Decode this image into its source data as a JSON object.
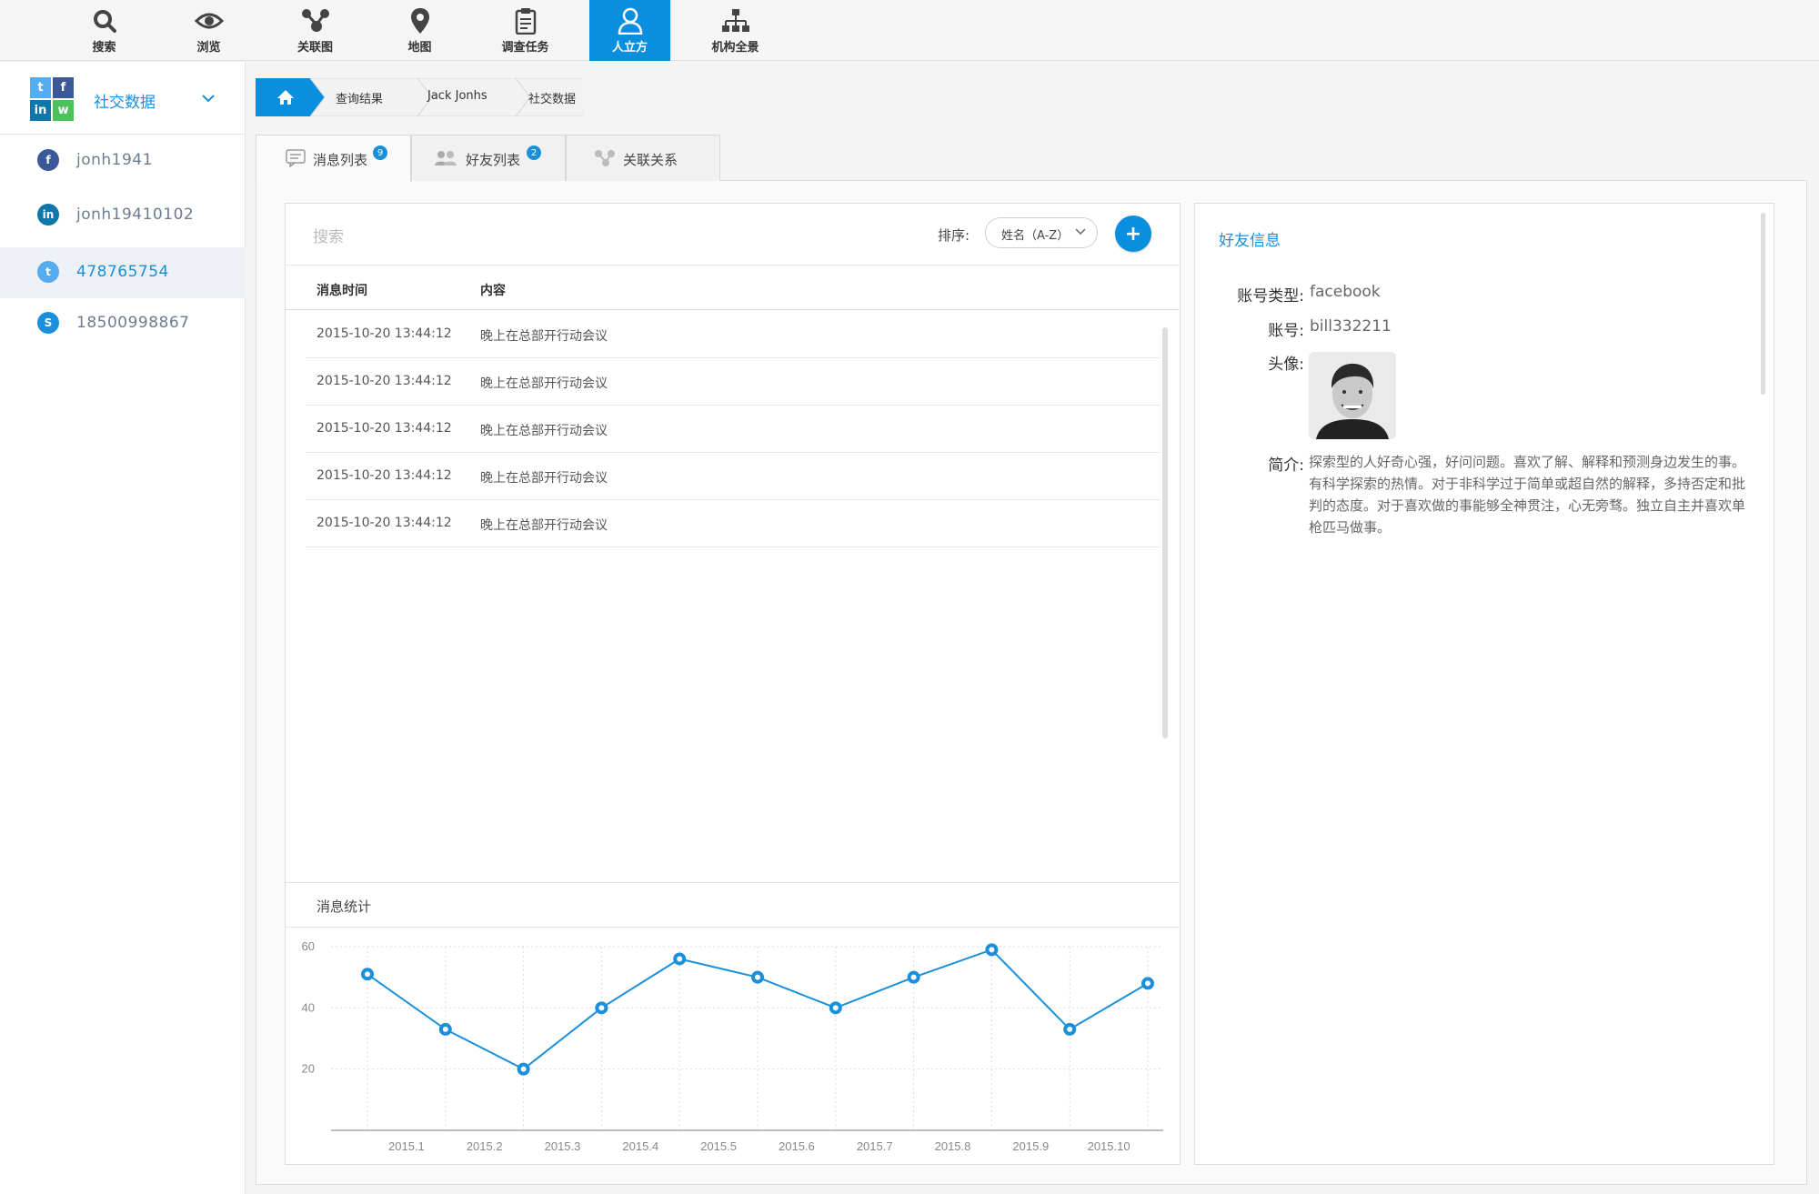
{
  "nav": {
    "items": [
      {
        "label": "搜索",
        "icon": "search-icon"
      },
      {
        "label": "浏览",
        "icon": "eye-icon"
      },
      {
        "label": "关联图",
        "icon": "graph-icon"
      },
      {
        "label": "地图",
        "icon": "map-pin-icon"
      },
      {
        "label": "调查任务",
        "icon": "clipboard-icon"
      },
      {
        "label": "人立方",
        "icon": "person-icon"
      },
      {
        "label": "机构全景",
        "icon": "org-chart-icon"
      }
    ],
    "active_index": 5,
    "accent_color": "#0a8fde"
  },
  "sidebar": {
    "title": "社交数据",
    "accounts": [
      {
        "label": "jonh1941",
        "icon": "facebook-icon",
        "color": "#3b5998"
      },
      {
        "label": "jonh19410102",
        "icon": "linkedin-icon",
        "color": "#0e76a8"
      },
      {
        "label": "478765754",
        "icon": "twitter-icon",
        "color": "#55acee"
      },
      {
        "label": "18500998867",
        "icon": "skype-icon",
        "color": "#1a8fdc"
      }
    ],
    "active_index": 2
  },
  "breadcrumb": {
    "items": [
      "查询结果",
      "Jack Jonhs",
      "社交数据"
    ]
  },
  "tabs": [
    {
      "label": "消息列表",
      "badge": "9",
      "icon": "message-icon"
    },
    {
      "label": "好友列表",
      "badge": "2",
      "icon": "friends-icon"
    },
    {
      "label": "关联关系",
      "badge": "",
      "icon": "relation-icon"
    }
  ],
  "messages": {
    "search_placeholder": "搜索",
    "sort_label": "排序:",
    "sort_value": "姓名（A-Z）",
    "add_label": "+",
    "columns": [
      "消息时间",
      "内容"
    ],
    "rows": [
      {
        "time": "2015-10-20 13:44:12",
        "content": "晚上在总部开行动会议"
      },
      {
        "time": "2015-10-20 13:44:12",
        "content": "晚上在总部开行动会议"
      },
      {
        "time": "2015-10-20 13:44:12",
        "content": "晚上在总部开行动会议"
      },
      {
        "time": "2015-10-20 13:44:12",
        "content": "晚上在总部开行动会议"
      },
      {
        "time": "2015-10-20 13:44:12",
        "content": "晚上在总部开行动会议"
      }
    ]
  },
  "stats": {
    "title": "消息统计"
  },
  "chart_data": {
    "type": "line",
    "x": [
      "2015.1",
      "2015.2",
      "2015.3",
      "2015.4",
      "2015.5",
      "2015.6",
      "2015.7",
      "2015.8",
      "2015.9",
      "2015.10"
    ],
    "series": [
      {
        "values": [
          51,
          33,
          20,
          40,
          56,
          50,
          40,
          50,
          59,
          33,
          48
        ]
      }
    ],
    "yticks": [
      20,
      40,
      60
    ],
    "ylim": [
      0,
      60
    ],
    "grid": true,
    "color": "#1a8fdc"
  },
  "friend": {
    "title": "好友信息",
    "type_label": "账号类型:",
    "type_value": "facebook",
    "account_label": "账号:",
    "account_value": "bill332211",
    "avatar_label": "头像:",
    "bio_label": "简介:",
    "bio": "探索型的人好奇心强，好问问题。喜欢了解、解释和预测身边发生的事。有科学探索的热情。对于非科学过于简单或超自然的解释，多持否定和批判的态度。对于喜欢做的事能够全神贯注，心无旁骛。独立自主并喜欢单枪匹马做事。"
  }
}
